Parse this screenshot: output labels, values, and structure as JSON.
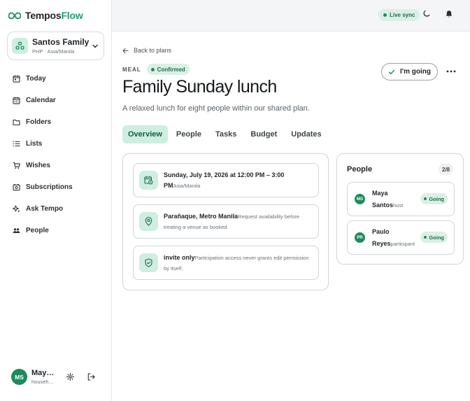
{
  "brand": {
    "prefix": "Tempos",
    "suffix": "Flow"
  },
  "family": {
    "name": "Santos Family",
    "meta": "PHP · Asia/Manila"
  },
  "nav": [
    {
      "label": "Today",
      "icon": "calendar-day-icon"
    },
    {
      "label": "Calendar",
      "icon": "calendar-grid-icon"
    },
    {
      "label": "Folders",
      "icon": "folder-icon"
    },
    {
      "label": "Lists",
      "icon": "list-icon"
    },
    {
      "label": "Wishes",
      "icon": "cart-icon"
    },
    {
      "label": "Subscriptions",
      "icon": "subscription-icon"
    },
    {
      "label": "Ask Tempo",
      "icon": "sparkle-icon"
    },
    {
      "label": "People",
      "icon": "people-icon"
    }
  ],
  "user": {
    "initials": "MS",
    "name": "Maya …",
    "role": "househol…"
  },
  "topbar": {
    "live_sync": "Live sync"
  },
  "plan": {
    "back_label": "Back to plans",
    "kind": "MEAL",
    "status": "Confirmed",
    "title": "Family Sunday lunch",
    "description": "A relaxed lunch for eight people within our shared plan.",
    "going_label": "I'm going"
  },
  "tabs": [
    {
      "label": "Overview",
      "active": true
    },
    {
      "label": "People",
      "active": false
    },
    {
      "label": "Tasks",
      "active": false
    },
    {
      "label": "Budget",
      "active": false
    },
    {
      "label": "Updates",
      "active": false
    }
  ],
  "details": [
    {
      "main": "Sunday, July 19, 2026 at 12:00 PM – 3:00 PM",
      "sub": "Asia/Manila",
      "icon": "calendar-clock-icon"
    },
    {
      "main": "Parañaque, Metro Manila",
      "sub": "Request availability before treating a venue as booked.",
      "icon": "location-pin-icon"
    },
    {
      "main": "invite only",
      "sub": "Participation access never grants edit permission by itself.",
      "icon": "shield-check-icon"
    }
  ],
  "people": {
    "title": "People",
    "count": "2/8",
    "list": [
      {
        "initials": "MS",
        "first": "Maya",
        "last": "Santos",
        "role": "host",
        "status": "Going"
      },
      {
        "initials": "PR",
        "first": "Paulo",
        "last": "Reyes",
        "role": "participant",
        "status": "Going"
      }
    ]
  },
  "colors": {
    "accent": "#1f8a5e",
    "accent_soft": "#cdeee0",
    "badge_bg": "#dcefe5"
  }
}
